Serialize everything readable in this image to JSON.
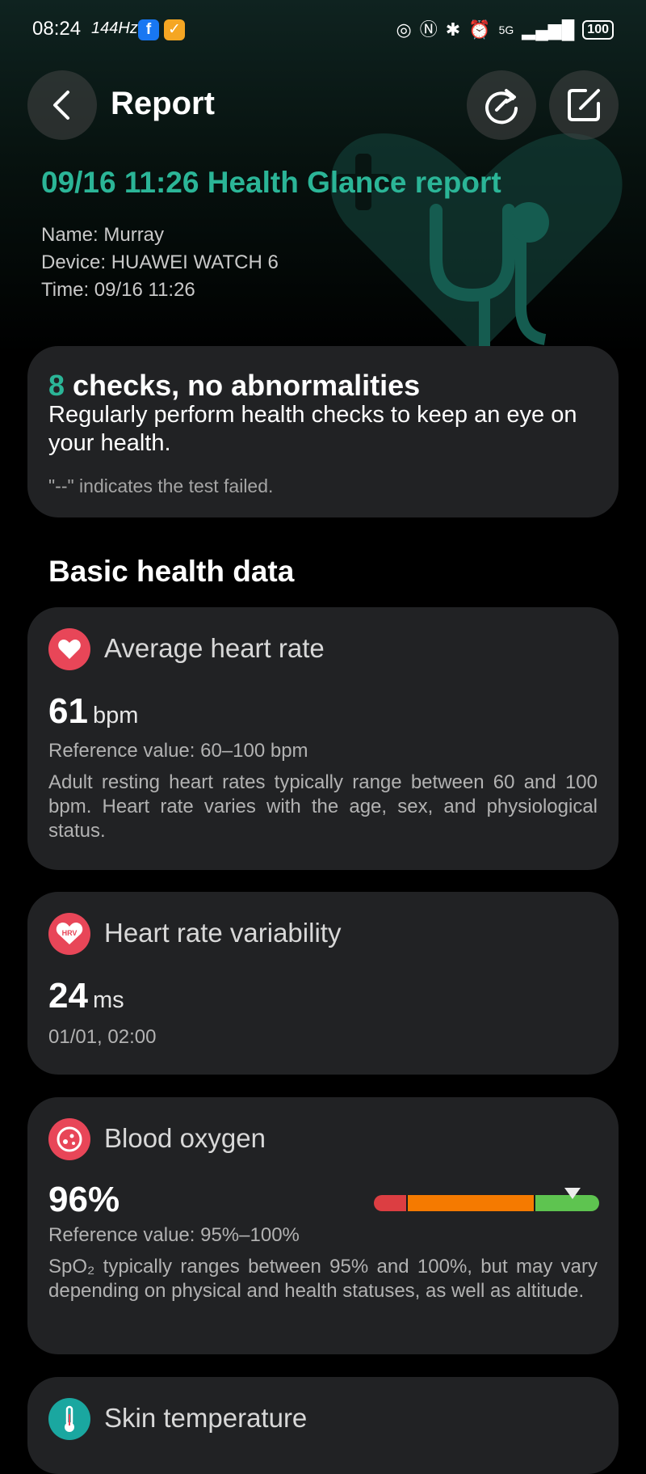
{
  "status_bar": {
    "time": "08:24",
    "refresh_rate": "144Hz",
    "fb_badge": "f",
    "health_badge": "✓",
    "network": "5G",
    "battery": "100"
  },
  "header": {
    "title": "Report"
  },
  "report": {
    "title": "09/16 11:26 Health Glance report",
    "name_line": "Name: Murray",
    "device_line": "Device: HUAWEI WATCH 6",
    "time_line": "Time: 09/16 11:26"
  },
  "summary": {
    "count": "8",
    "headline": " checks, no abnormalities",
    "description": "Regularly perform health checks to keep an eye on your health.",
    "note": "\"--\" indicates the test failed."
  },
  "section_title": "Basic health data",
  "metrics": {
    "heart_rate": {
      "title": "Average heart rate",
      "value": "61",
      "unit": "bpm",
      "reference": "Reference value: 60–100 bpm",
      "description": "Adult resting heart rates typically range between 60 and 100 bpm. Heart rate varies with the age, sex, and physiological status."
    },
    "hrv": {
      "title": "Heart rate variability",
      "icon_text": "HRV",
      "value": "24",
      "unit": "ms",
      "timestamp": "01/01, 02:00"
    },
    "blood_oxygen": {
      "title": "Blood oxygen",
      "value": "96%",
      "reference": "Reference value: 95%–100%",
      "description": "SpO₂ typically ranges between 95% and 100%, but may vary depending on physical and health statuses, as well as altitude."
    },
    "skin_temperature": {
      "title": "Skin temperature"
    }
  },
  "colors": {
    "accent": "#2bb597",
    "card_bg": "#212224",
    "icon_red": "#e84658",
    "bar_red": "#dc3e42",
    "bar_orange": "#f57a00",
    "bar_green": "#5ec450",
    "skin_icon": "#1aa7a0"
  },
  "icons": [
    "back-arrow-icon",
    "refresh-icon",
    "edit-icon",
    "heart-icon",
    "hrv-icon",
    "blood-oxygen-icon",
    "thermometer-icon"
  ]
}
